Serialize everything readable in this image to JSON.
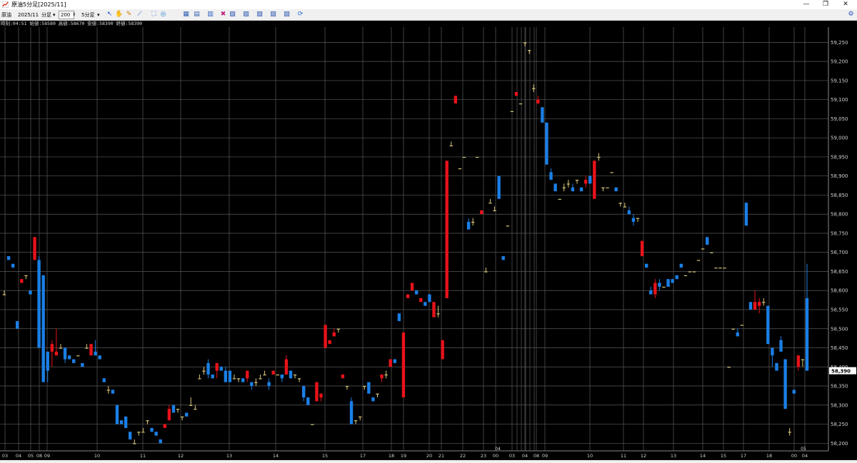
{
  "window": {
    "title": "原油5分足[2025/11]",
    "minimize_glyph": "—",
    "maximize_glyph": "❐",
    "close_glyph": "✕"
  },
  "toolbar": {
    "symbol": "原油",
    "contract": "2025/11",
    "period_unit": "分足",
    "bar_count": "200",
    "timeframe": "5分足",
    "icons": [
      "cursor-icon",
      "hand-icon",
      "pencil-icon",
      "line-tool-icon",
      "fullscreen-icon",
      "refresh-icon",
      "grid-icon",
      "table-icon",
      "indicator-icon",
      "delete-icon",
      "chart-type-icon-1",
      "chart-type-icon-2",
      "chart-type-icon-3",
      "chart-type-icon-4",
      "chart-type-icon-5",
      "sync-icon",
      "settings-icon"
    ]
  },
  "ohlc_readout": "時刻:04:51 始値:58580 高値:58670 安値:58390 終値:58390",
  "colors": {
    "background": "#000000",
    "up": "#e8121a",
    "down": "#1b7fe6",
    "doji": "#d8c77a",
    "grid": "#5a5a5a",
    "price_tag_bg": "#ffffff"
  },
  "chart_data": {
    "type": "candlestick",
    "last_price": "58,390",
    "y_ticks": [
      "59,250",
      "59,200",
      "59,150",
      "59,100",
      "59,050",
      "59,000",
      "58,950",
      "58,900",
      "58,850",
      "58,800",
      "58,750",
      "58,700",
      "58,650",
      "58,600",
      "58,550",
      "58,500",
      "58,450",
      "58,400",
      "58,350",
      "58,300",
      "58,250",
      "58,200"
    ],
    "ylim": [
      58180,
      59290
    ],
    "x_labels": [
      "03",
      "04",
      "05",
      "08",
      "09",
      "10",
      "11",
      "12",
      "13",
      "14",
      "15",
      "17",
      "18",
      "19",
      "20",
      "21",
      "22",
      "23",
      "00",
      "04",
      "03",
      "04",
      "08",
      "09",
      "10",
      "11",
      "12",
      "13",
      "14",
      "15",
      "17",
      "18",
      "00",
      "04"
    ],
    "x_top_labels": [
      "04",
      "05"
    ],
    "candles": [
      [
        58590,
        58600,
        58590,
        58590
      ],
      [
        58690,
        58690,
        58680,
        58680
      ],
      [
        58670,
        58670,
        58660,
        58660
      ],
      [
        58520,
        58520,
        58500,
        58500
      ],
      [
        58620,
        58630,
        58620,
        58630
      ],
      [
        58640,
        58640,
        58630,
        58640
      ],
      [
        58600,
        58600,
        58590,
        58590
      ],
      [
        58680,
        58740,
        58680,
        58740
      ],
      [
        58680,
        58690,
        58450,
        58450
      ],
      [
        58640,
        58640,
        58360,
        58360
      ],
      [
        58440,
        58440,
        58360,
        58390
      ],
      [
        58440,
        58470,
        58400,
        58460
      ],
      [
        58430,
        58500,
        58430,
        58440
      ],
      [
        58450,
        58460,
        58450,
        58450
      ],
      [
        58450,
        58450,
        58410,
        58420
      ],
      [
        58430,
        58430,
        58420,
        58420
      ],
      [
        58420,
        58420,
        58410,
        58410
      ],
      [
        58430,
        58430,
        58430,
        58430
      ],
      [
        58410,
        58410,
        58400,
        58400
      ],
      [
        58450,
        58460,
        58450,
        58450
      ],
      [
        58430,
        58460,
        58430,
        58460
      ],
      [
        58440,
        58470,
        58430,
        58430
      ],
      [
        58430,
        58430,
        58420,
        58420
      ],
      [
        58370,
        58370,
        58360,
        58360
      ],
      [
        58340,
        58350,
        58330,
        58340
      ],
      [
        58340,
        58340,
        58330,
        58330
      ],
      [
        58300,
        58300,
        58250,
        58250
      ],
      [
        58260,
        58260,
        58250,
        58250
      ],
      [
        58270,
        58270,
        58240,
        58240
      ],
      [
        58230,
        58230,
        58210,
        58210
      ],
      [
        58200,
        58210,
        58200,
        58200
      ],
      [
        58230,
        58230,
        58220,
        58230
      ],
      [
        58230,
        58240,
        58230,
        58230
      ],
      [
        58260,
        58260,
        58250,
        58260
      ],
      [
        58240,
        58240,
        58230,
        58230
      ],
      [
        58230,
        58230,
        58220,
        58220
      ],
      [
        58210,
        58210,
        58200,
        58200
      ],
      [
        58240,
        58250,
        58240,
        58250
      ],
      [
        58260,
        58300,
        58260,
        58290
      ],
      [
        58300,
        58300,
        58280,
        58280
      ],
      [
        58290,
        58290,
        58280,
        58290
      ],
      [
        58270,
        58270,
        58260,
        58270
      ],
      [
        58280,
        58280,
        58270,
        58270
      ],
      [
        58300,
        58320,
        58300,
        58300
      ],
      [
        58290,
        58300,
        58290,
        58290
      ],
      [
        58370,
        58380,
        58370,
        58370
      ],
      [
        58390,
        58400,
        58380,
        58390
      ],
      [
        58410,
        58420,
        58370,
        58380
      ],
      [
        58380,
        58380,
        58370,
        58370
      ],
      [
        58390,
        58410,
        58370,
        58410
      ],
      [
        58400,
        58400,
        58390,
        58390
      ],
      [
        58390,
        58400,
        58360,
        58360
      ],
      [
        58390,
        58390,
        58360,
        58360
      ],
      [
        58370,
        58380,
        58370,
        58370
      ],
      [
        58370,
        58370,
        58360,
        58370
      ],
      [
        58370,
        58370,
        58360,
        58360
      ],
      [
        58370,
        58380,
        58360,
        58390
      ],
      [
        58360,
        58360,
        58340,
        58350
      ],
      [
        58360,
        58370,
        58350,
        58360
      ],
      [
        58370,
        58380,
        58370,
        58370
      ],
      [
        58380,
        58390,
        58380,
        58380
      ],
      [
        58360,
        58370,
        58340,
        58350
      ],
      [
        58380,
        58390,
        58380,
        58390
      ],
      [
        58380,
        58380,
        58380,
        58380
      ],
      [
        58380,
        58380,
        58360,
        58370
      ],
      [
        58380,
        58430,
        58380,
        58420
      ],
      [
        58390,
        58390,
        58370,
        58370
      ],
      [
        58380,
        58380,
        58370,
        58380
      ],
      [
        58370,
        58370,
        58360,
        58370
      ],
      [
        58350,
        58350,
        58310,
        58320
      ],
      [
        58320,
        58320,
        58300,
        58300
      ],
      [
        58250,
        58250,
        58250,
        58250
      ],
      [
        58310,
        58360,
        58310,
        58360
      ],
      [
        58320,
        58330,
        58310,
        58330
      ],
      [
        58450,
        58510,
        58450,
        58510
      ],
      [
        58460,
        58470,
        58460,
        58470
      ],
      [
        58480,
        58500,
        58480,
        58490
      ],
      [
        58500,
        58500,
        58490,
        58500
      ],
      [
        58370,
        58380,
        58370,
        58380
      ],
      [
        58350,
        58350,
        58340,
        58350
      ],
      [
        58310,
        58320,
        58250,
        58250
      ],
      [
        58260,
        58260,
        58250,
        58260
      ],
      [
        58270,
        58270,
        58260,
        58270
      ],
      [
        58350,
        58350,
        58340,
        58350
      ],
      [
        58360,
        58360,
        58330,
        58330
      ],
      [
        58320,
        58320,
        58310,
        58310
      ],
      [
        58330,
        58330,
        58320,
        58330
      ],
      [
        58370,
        58380,
        58360,
        58380
      ],
      [
        58380,
        58390,
        58370,
        58380
      ],
      [
        58400,
        58420,
        58400,
        58420
      ],
      [
        58420,
        58420,
        58410,
        58410
      ],
      [
        58540,
        58540,
        58520,
        58520
      ],
      [
        58320,
        58490,
        58320,
        58490
      ],
      [
        58580,
        58590,
        58580,
        58590
      ],
      [
        58600,
        58620,
        58600,
        58620
      ],
      [
        58600,
        58600,
        58590,
        58590
      ],
      [
        58570,
        58580,
        58570,
        58580
      ],
      [
        58570,
        58570,
        58560,
        58560
      ],
      [
        58590,
        58590,
        58570,
        58570
      ],
      [
        58530,
        58570,
        58530,
        58570
      ],
      [
        58540,
        58560,
        58530,
        58540
      ],
      [
        58420,
        58470,
        58420,
        58470
      ],
      [
        58580,
        58940,
        58580,
        58940
      ],
      [
        58980,
        58990,
        58980,
        58980
      ],
      [
        59090,
        59110,
        59090,
        59110
      ],
      [
        58920,
        58920,
        58920,
        58920
      ],
      [
        58950,
        58950,
        58950,
        58950
      ],
      [
        58780,
        58790,
        58760,
        58760
      ],
      [
        58780,
        58790,
        58770,
        58780
      ],
      [
        58950,
        58950,
        58950,
        58950
      ],
      [
        58800,
        58810,
        58800,
        58810
      ],
      [
        58650,
        58660,
        58650,
        58650
      ],
      [
        58830,
        58840,
        58830,
        58830
      ],
      [
        58810,
        58820,
        58810,
        58810
      ],
      [
        58900,
        58900,
        58840,
        58840
      ],
      [
        58690,
        58690,
        58680,
        58680
      ],
      [
        58770,
        58770,
        58770,
        58770
      ],
      [
        59070,
        59070,
        59070,
        59070
      ],
      [
        59110,
        59120,
        59110,
        59120
      ],
      [
        59090,
        59090,
        59090,
        59090
      ],
      [
        59250,
        59250,
        59240,
        59250
      ],
      [
        59230,
        59230,
        59220,
        59230
      ],
      [
        59130,
        59140,
        59120,
        59130
      ],
      [
        59090,
        59110,
        59090,
        59100
      ],
      [
        59080,
        59080,
        59040,
        59040
      ],
      [
        59040,
        59040,
        58930,
        58930
      ],
      [
        58910,
        58920,
        58890,
        58890
      ],
      [
        58880,
        58880,
        58860,
        58860
      ],
      [
        58840,
        58840,
        58840,
        58840
      ],
      [
        58870,
        58880,
        58860,
        58870
      ],
      [
        58880,
        58890,
        58870,
        58880
      ],
      [
        58870,
        58880,
        58860,
        58860
      ],
      [
        58890,
        58890,
        58880,
        58890
      ],
      [
        58870,
        58870,
        58860,
        58860
      ],
      [
        58880,
        58900,
        58870,
        58890
      ],
      [
        58900,
        58900,
        58880,
        58880
      ],
      [
        58840,
        58940,
        58840,
        58940
      ],
      [
        58950,
        58960,
        58940,
        58950
      ],
      [
        58870,
        58870,
        58860,
        58870
      ],
      [
        58870,
        58870,
        58870,
        58870
      ],
      [
        58910,
        58910,
        58910,
        58910
      ],
      [
        58870,
        58870,
        58860,
        58860
      ],
      [
        58830,
        58830,
        58820,
        58830
      ],
      [
        58820,
        58830,
        58820,
        58820
      ],
      [
        58810,
        58820,
        58800,
        58800
      ],
      [
        58790,
        58800,
        58770,
        58780
      ],
      [
        58790,
        58790,
        58780,
        58790
      ],
      [
        58690,
        58730,
        58690,
        58730
      ],
      [
        58670,
        58670,
        58660,
        58660
      ],
      [
        58600,
        58610,
        58590,
        58590
      ],
      [
        58590,
        58630,
        58580,
        58620
      ],
      [
        58620,
        58630,
        58600,
        58610
      ],
      [
        58610,
        58610,
        58610,
        58610
      ],
      [
        58630,
        58630,
        58610,
        58610
      ],
      [
        58630,
        58630,
        58620,
        58620
      ],
      [
        58640,
        58640,
        58630,
        58630
      ],
      [
        58670,
        58670,
        58660,
        58660
      ],
      [
        58640,
        58640,
        58640,
        58640
      ],
      [
        58650,
        58650,
        58650,
        58650
      ],
      [
        58650,
        58650,
        58650,
        58650
      ],
      [
        58680,
        58680,
        58680,
        58680
      ],
      [
        58710,
        58710,
        58710,
        58710
      ],
      [
        58740,
        58740,
        58720,
        58720
      ],
      [
        58700,
        58700,
        58700,
        58700
      ],
      [
        58660,
        58660,
        58660,
        58660
      ],
      [
        58660,
        58660,
        58660,
        58660
      ],
      [
        58660,
        58660,
        58660,
        58660
      ],
      [
        58400,
        58400,
        58400,
        58400
      ],
      [
        58500,
        58500,
        58500,
        58500
      ],
      [
        58490,
        58500,
        58480,
        58480
      ],
      [
        58510,
        58510,
        58510,
        58510
      ],
      [
        58830,
        58830,
        58770,
        58770
      ],
      [
        58570,
        58570,
        58550,
        58550
      ],
      [
        58550,
        58600,
        58550,
        58570
      ],
      [
        58560,
        58580,
        58540,
        58570
      ],
      [
        58570,
        58580,
        58560,
        58570
      ],
      [
        58560,
        58560,
        58460,
        58460
      ],
      [
        58450,
        58450,
        58400,
        58430
      ],
      [
        58410,
        58410,
        58390,
        58390
      ],
      [
        58470,
        58480,
        58440,
        58440
      ],
      [
        58420,
        58420,
        58300,
        58290
      ],
      [
        58230,
        58240,
        58220,
        58230
      ],
      [
        58340,
        58340,
        58330,
        58330
      ],
      [
        58400,
        58430,
        58390,
        58430
      ],
      [
        58420,
        58420,
        58400,
        58420
      ],
      [
        58580,
        58670,
        58390,
        58390
      ]
    ]
  }
}
